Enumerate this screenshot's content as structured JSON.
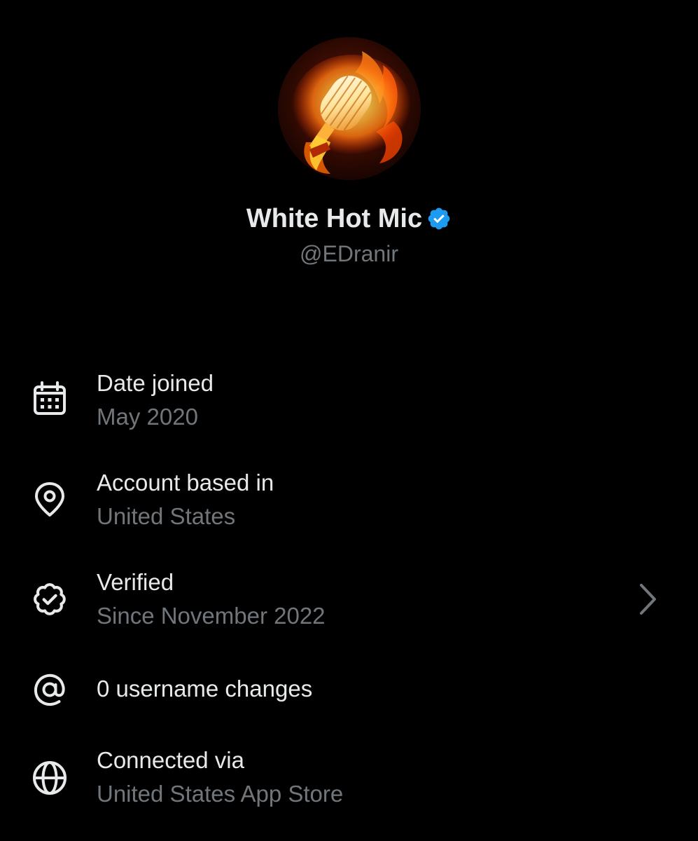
{
  "profile": {
    "display_name": "White Hot Mic",
    "handle": "@EDranir",
    "avatar_icon": "flaming-microphone-avatar",
    "verified_badge_color": "#1d9bf0"
  },
  "about": {
    "date_joined": {
      "title": "Date joined",
      "value": "May 2020",
      "icon": "calendar-icon"
    },
    "account_based_in": {
      "title": "Account based in",
      "value": "United States",
      "icon": "location-pin-icon"
    },
    "verified": {
      "title": "Verified",
      "value": "Since November 2022",
      "icon": "verified-badge-outline-icon"
    },
    "username_changes": {
      "title": "0 username changes",
      "icon": "at-sign-icon"
    },
    "connected_via": {
      "title": "Connected via",
      "value": "United States App Store",
      "icon": "globe-icon"
    }
  },
  "colors": {
    "background": "#000000",
    "primary_text": "#e7e9ea",
    "secondary_text": "#71767b",
    "accent_blue": "#1d9bf0"
  }
}
